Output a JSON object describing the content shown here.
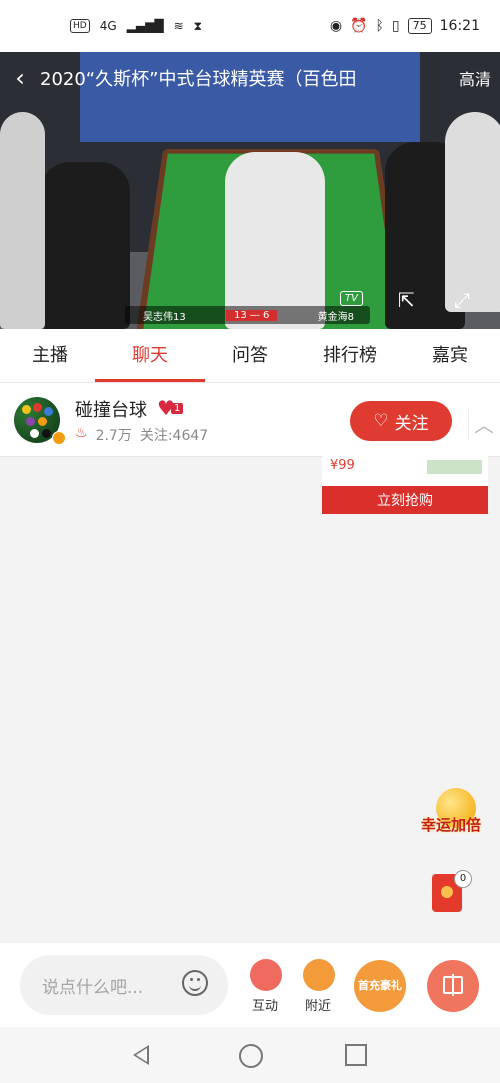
{
  "status_bar": {
    "hd": "HD",
    "network": "4G",
    "battery": "75",
    "time": "16:21"
  },
  "video": {
    "title": "2020“久斯杯”中式台球精英赛（百色田",
    "quality": "高清",
    "scoreboard": {
      "player1": "吴志伟13",
      "score": "13 — 6",
      "player2": "黄金海8"
    },
    "tv_label": "TV"
  },
  "tabs": [
    {
      "label": "主播",
      "active": false
    },
    {
      "label": "聊天",
      "active": true
    },
    {
      "label": "问答",
      "active": false
    },
    {
      "label": "排行榜",
      "active": false
    },
    {
      "label": "嘉宾",
      "active": false
    }
  ],
  "streamer": {
    "name": "碰撞台球",
    "badge_level": "1",
    "heat": "2.7万",
    "followers": "关注:4647",
    "follow_label": "关注"
  },
  "product": {
    "price": "¥99",
    "buy_label": "立刻抢购"
  },
  "floating": {
    "promo_text": "幸运加倍",
    "redpacket_count": "0"
  },
  "bottom_bar": {
    "input_placeholder": "说点什么吧...",
    "interact_label": "互动",
    "nearby_label": "附近",
    "recharge_text": "首充豪礼"
  },
  "colors": {
    "accent": "#e03b30",
    "orange": "#f39a3b"
  }
}
